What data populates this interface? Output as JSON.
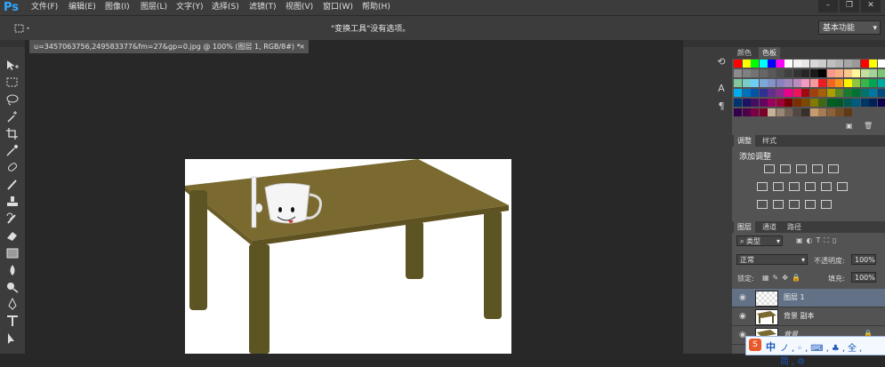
{
  "app": {
    "logo": "Ps"
  },
  "menu": [
    "文件(F)",
    "编辑(E)",
    "图像(I)",
    "图层(L)",
    "文字(Y)",
    "选择(S)",
    "滤镜(T)",
    "视图(V)",
    "窗口(W)",
    "帮助(H)"
  ],
  "window_controls": [
    "–",
    "❐",
    "✕"
  ],
  "options_bar": {
    "message": "\"变换工具\"没有选项。",
    "workspace": "基本功能"
  },
  "document": {
    "tab_title": "u=3457063756,249583377&fm=27&gp=0.jpg @ 100% (图层 1, RGB/8#) *",
    "close": "×"
  },
  "panels": {
    "color_tabs": [
      "颜色",
      "色板"
    ],
    "adjust_tabs": [
      "调整",
      "样式"
    ],
    "adjust_title": "添加调整",
    "layer_tabs": [
      "图层",
      "通道",
      "路径"
    ],
    "filter_kind": "类型",
    "blend_mode": "正常",
    "opacity_label": "不透明度:",
    "opacity_value": "100%",
    "lock_label": "锁定:",
    "fill_label": "填充:",
    "fill_value": "100%",
    "layers": [
      {
        "name": "图层 1",
        "selected": true
      },
      {
        "name": "背景 副本",
        "selected": false
      },
      {
        "name": "背景",
        "selected": false
      }
    ]
  },
  "ime_bar": {
    "text": "中",
    "symbols": "ノ,◦,⌨,♣,全,简,⚙"
  },
  "colors": {
    "accent": "#31a8ff",
    "table_top": "#7a6a30",
    "table_leg": "#5c5422",
    "selected_layer": "#627186"
  }
}
